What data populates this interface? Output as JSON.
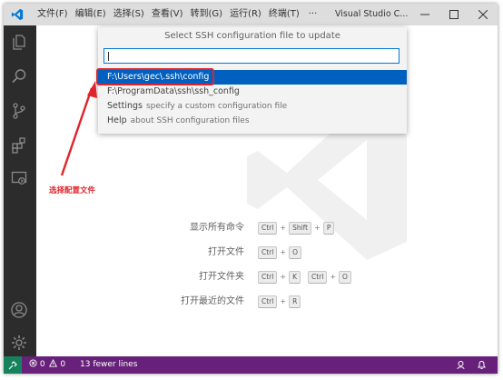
{
  "titlebar": {
    "menu": [
      "文件(F)",
      "编辑(E)",
      "选择(S)",
      "查看(V)",
      "转到(G)",
      "运行(R)",
      "终端(T)"
    ],
    "more": "···",
    "window_title": "Visual Studio C...",
    "logo_color": "#0078d4"
  },
  "activity_bar": {
    "icons": [
      "explorer-icon",
      "search-icon",
      "source-control-icon",
      "extensions-icon",
      "remote-explorer-icon",
      "account-icon",
      "manage-gear-icon"
    ]
  },
  "quick_pick": {
    "title": "Select SSH configuration file to update",
    "input_value": "",
    "items": [
      {
        "label": "F:\\Users\\gec\\.ssh\\config",
        "description": "",
        "selected": true
      },
      {
        "label": "F:\\ProgramData\\ssh\\ssh_config",
        "description": ""
      },
      {
        "label": "Settings",
        "description": "specify a custom configuration file"
      },
      {
        "label": "Help",
        "description": "about SSH configuration files"
      }
    ]
  },
  "annotation": {
    "text": "选择配置文件",
    "color": "#e0242b"
  },
  "shortcuts": [
    {
      "label": "显示所有命令",
      "keys": [
        [
          "Ctrl",
          "Shift",
          "P"
        ]
      ]
    },
    {
      "label": "打开文件",
      "keys": [
        [
          "Ctrl",
          "O"
        ]
      ]
    },
    {
      "label": "打开文件夹",
      "keys": [
        [
          "Ctrl",
          "K"
        ],
        [
          "Ctrl",
          "O"
        ]
      ]
    },
    {
      "label": "打开最近的文件",
      "keys": [
        [
          "Ctrl",
          "R"
        ]
      ]
    }
  ],
  "statusbar": {
    "remote_icon": "remote-indicator-icon",
    "errors": "0",
    "warnings": "0",
    "message": "13 fewer lines",
    "background": "#68217a",
    "remote_background": "#16825d"
  }
}
